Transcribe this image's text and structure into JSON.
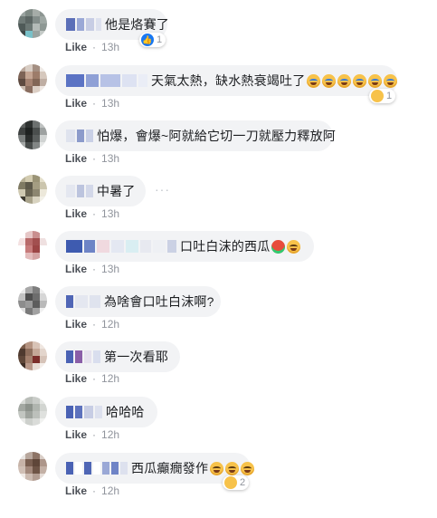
{
  "comments": [
    {
      "text": "他是烙賽了",
      "emojis": [],
      "like_label": "Like",
      "time": "13h",
      "reaction": {
        "icon": "like-icon",
        "count": "1"
      }
    },
    {
      "text": "天氣太熱，缺水熱衰竭吐了",
      "emojis": [
        "crying-face-icon",
        "crying-face-icon",
        "crying-face-icon",
        "crying-face-icon",
        "crying-face-icon",
        "crying-face-icon"
      ],
      "like_label": "Like",
      "time": "13h",
      "reaction": {
        "icon": "haha-icon",
        "count": "1"
      }
    },
    {
      "text": "怕爆，會爆~阿就給它切一刀就壓力釋放阿",
      "emojis": [],
      "like_label": "Like",
      "time": "13h",
      "reaction": null
    },
    {
      "text": "中暑了",
      "emojis": [],
      "like_label": "Like",
      "time": "13h",
      "reaction": null,
      "more_icon": "more-options-icon"
    },
    {
      "text": "口吐白沫的西瓜",
      "emojis": [
        "watermelon-icon",
        "laughing-face-icon"
      ],
      "like_label": "Like",
      "time": "13h",
      "reaction": null
    },
    {
      "text": "為啥會口吐白沫啊?",
      "emojis": [],
      "like_label": "Like",
      "time": "12h",
      "reaction": null
    },
    {
      "text": "第一次看耶",
      "emojis": [],
      "like_label": "Like",
      "time": "12h",
      "reaction": null
    },
    {
      "text": "哈哈哈",
      "emojis": [],
      "like_label": "Like",
      "time": "12h",
      "reaction": null
    },
    {
      "text": "西瓜癲癇發作",
      "emojis": [
        "rofl-face-icon",
        "rofl-face-icon",
        "rofl-face-icon"
      ],
      "like_label": "Like",
      "time": "12h",
      "reaction": {
        "icon": "haha-icon",
        "count": "2"
      }
    }
  ],
  "colors": {
    "bubble": "#f2f3f5",
    "like_blue": "#1877f2",
    "meta_gray": "#90949c"
  }
}
